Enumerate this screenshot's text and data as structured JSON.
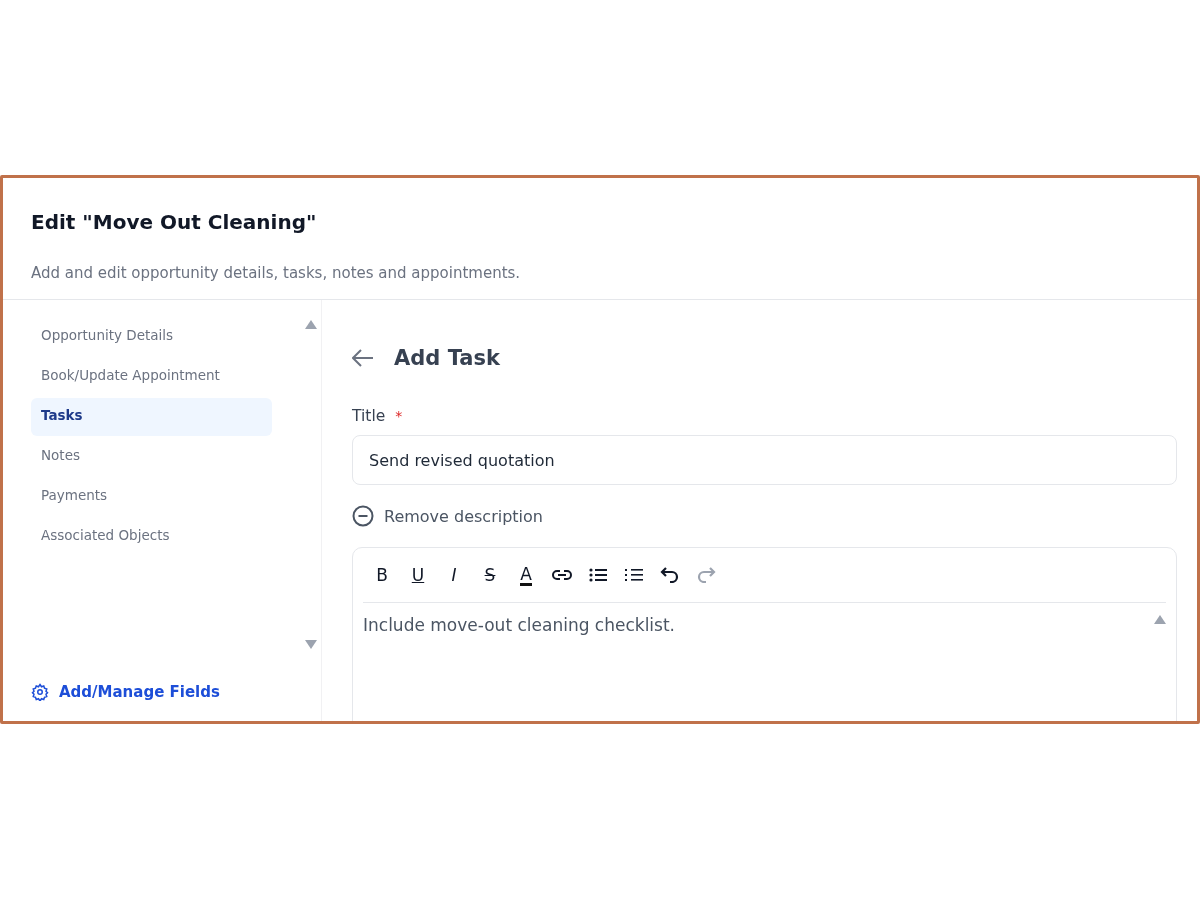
{
  "dialog": {
    "title": "Edit \"Move Out Cleaning\"",
    "subtitle": "Add and edit opportunity details, tasks, notes and appointments."
  },
  "sidebar": {
    "items": [
      {
        "label": "Opportunity Details",
        "selected": false
      },
      {
        "label": "Book/Update Appointment",
        "selected": false
      },
      {
        "label": "Tasks",
        "selected": true
      },
      {
        "label": "Notes",
        "selected": false
      },
      {
        "label": "Payments",
        "selected": false
      },
      {
        "label": "Associated Objects",
        "selected": false
      }
    ],
    "footer_link": "Add/Manage Fields"
  },
  "panel": {
    "heading": "Add Task",
    "title_field": {
      "label": "Title",
      "required_mark": "*",
      "value": "Send revised quotation"
    },
    "remove_description": "Remove description",
    "toolbar": [
      {
        "kind": "bold",
        "glyph": "B",
        "disabled": false
      },
      {
        "kind": "underline",
        "glyph": "U",
        "disabled": false
      },
      {
        "kind": "italic",
        "glyph": "I",
        "disabled": false
      },
      {
        "kind": "strike",
        "glyph": "S",
        "disabled": false
      },
      {
        "kind": "color",
        "glyph": "A",
        "disabled": false
      },
      {
        "kind": "link",
        "disabled": false
      },
      {
        "kind": "bullets",
        "disabled": false
      },
      {
        "kind": "numbers",
        "disabled": false
      },
      {
        "kind": "undo",
        "disabled": false
      },
      {
        "kind": "redo",
        "disabled": true
      }
    ],
    "description": "Include move-out cleaning checklist."
  }
}
